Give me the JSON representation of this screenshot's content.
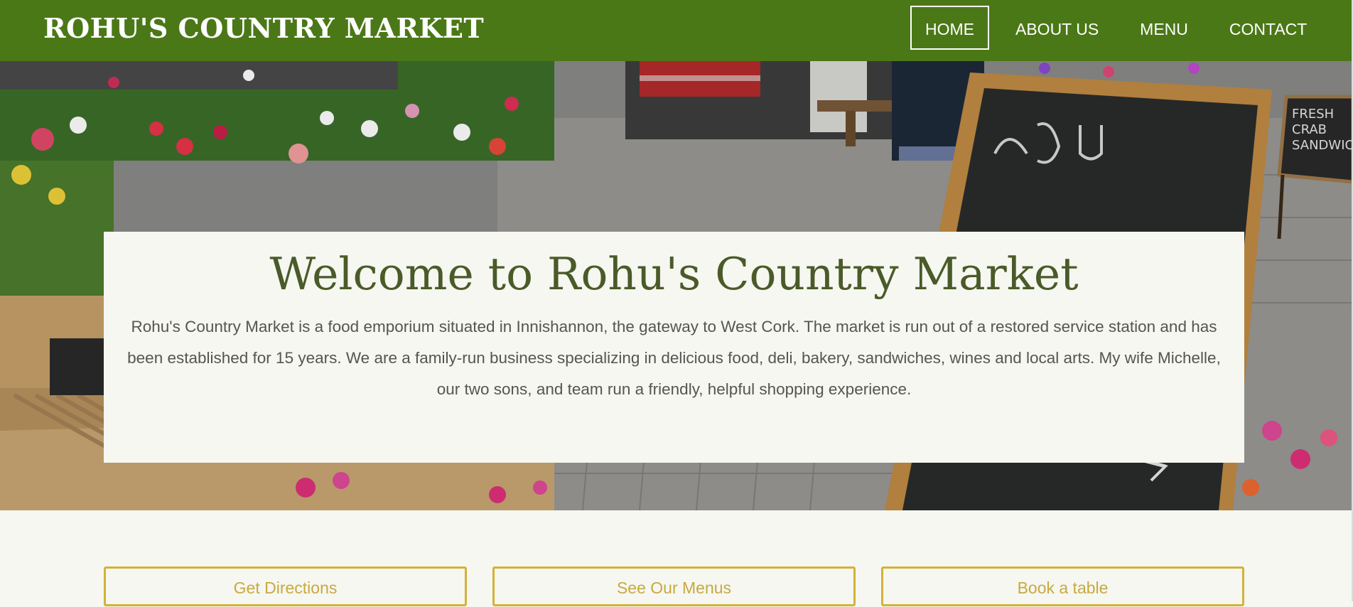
{
  "header": {
    "brand": "ROHU'S COUNTRY MARKET",
    "nav": [
      {
        "label": "HOME",
        "active": true
      },
      {
        "label": "ABOUT US",
        "active": false
      },
      {
        "label": "MENU",
        "active": false
      },
      {
        "label": "CONTACT",
        "active": false
      }
    ]
  },
  "hero": {
    "title": "Welcome to Rohu's Country Market",
    "text": "Rohu's Country Market is a food emporium situated in Innishannon, the gateway to West Cork. The market is run out of a restored service station and has been established for 15 years. We are a family-run business specializing in delicious food, deli, bakery, sandwiches, wines and local arts. My wife Michelle, our two sons, and team run a friendly, helpful shopping experience.",
    "sign_text": "FRESH CRAB SANDWICH"
  },
  "actions": {
    "directions": "Get Directions",
    "menus": "See Our Menus",
    "book": "Book a table"
  },
  "colors": {
    "header_bg": "#4b7817",
    "accent": "#d4b13a",
    "title": "#4a5a29",
    "page_bg": "#f5f7f0"
  }
}
